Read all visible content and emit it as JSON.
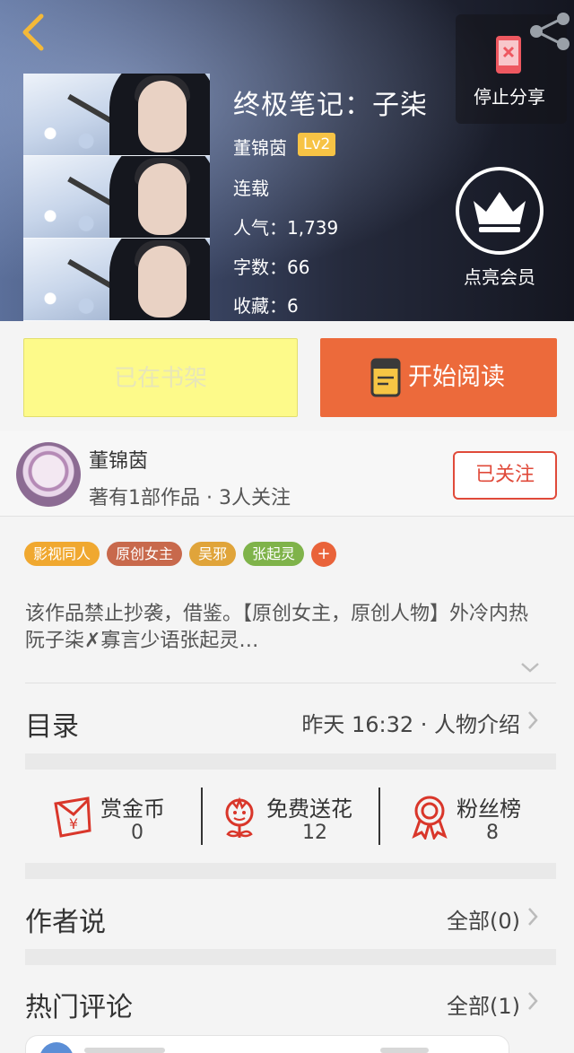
{
  "header": {
    "share_label": "停止分享",
    "title": "终极笔记：子柒",
    "author": "董锦茵",
    "level": "Lv2",
    "status": "连载",
    "popularity": "人气：1,739",
    "word_count": "字数：66",
    "favorites": "收藏：6",
    "vip_label": "点亮会员"
  },
  "actions": {
    "shelf_label": "已在书架",
    "read_label": "开始阅读"
  },
  "author_row": {
    "name": "董锦茵",
    "stats": "著有1部作品 · 3人关注",
    "follow_label": "已关注"
  },
  "tags": [
    {
      "label": "影视同人",
      "color": "#f0a830"
    },
    {
      "label": "原创女主",
      "color": "#c8694c"
    },
    {
      "label": "吴邪",
      "color": "#e0a43a"
    },
    {
      "label": "张起灵",
      "color": "#7fb34a"
    }
  ],
  "tag_more": "+",
  "description": "该作品禁止抄袭，借鉴。【原创女主，原创人物】外冷内热阮子柒✗寡言少语张起灵…",
  "catalog": {
    "title": "目录",
    "latest": "昨天 16:32 · 人物介绍"
  },
  "stats": [
    {
      "label": "赏金币",
      "value": "0",
      "icon": "reward-coin-icon"
    },
    {
      "label": "免费送花",
      "value": "12",
      "icon": "flower-icon"
    },
    {
      "label": "粉丝榜",
      "value": "8",
      "icon": "medal-icon"
    }
  ],
  "author_says": {
    "title": "作者说",
    "all": "全部(0)"
  },
  "hot_comments": {
    "title": "热门评论",
    "all": "全部(1)"
  },
  "colors": {
    "accent": "#ec6a3b",
    "follow": "#e04a3a",
    "shelf_bg": "#fdfa8a",
    "level_badge": "#f7c345"
  }
}
